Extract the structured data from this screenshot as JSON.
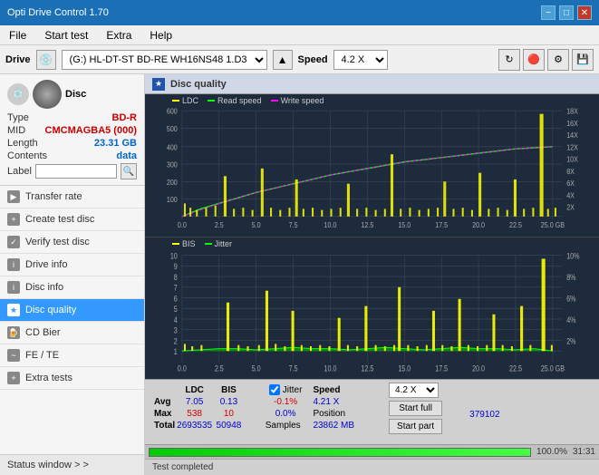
{
  "titlebar": {
    "title": "Opti Drive Control 1.70",
    "min_label": "−",
    "max_label": "□",
    "close_label": "✕"
  },
  "menubar": {
    "items": [
      "File",
      "Start test",
      "Extra",
      "Help"
    ]
  },
  "drivebar": {
    "label": "Drive",
    "drive_value": "(G:)  HL-DT-ST BD-RE  WH16NS48 1.D3",
    "speed_label": "Speed",
    "speed_value": "4.2 X"
  },
  "disc": {
    "title": "Disc",
    "type_label": "Type",
    "type_value": "BD-R",
    "mid_label": "MID",
    "mid_value": "CMCMAGBA5 (000)",
    "length_label": "Length",
    "length_value": "23.31 GB",
    "contents_label": "Contents",
    "contents_value": "data",
    "label_label": "Label"
  },
  "sidebar_nav": {
    "items": [
      {
        "id": "transfer-rate",
        "label": "Transfer rate",
        "active": false
      },
      {
        "id": "create-test-disc",
        "label": "Create test disc",
        "active": false
      },
      {
        "id": "verify-test-disc",
        "label": "Verify test disc",
        "active": false
      },
      {
        "id": "drive-info",
        "label": "Drive info",
        "active": false
      },
      {
        "id": "disc-info",
        "label": "Disc info",
        "active": false
      },
      {
        "id": "disc-quality",
        "label": "Disc quality",
        "active": true
      },
      {
        "id": "cd-bier",
        "label": "CD Bier",
        "active": false
      },
      {
        "id": "fe-te",
        "label": "FE / TE",
        "active": false
      },
      {
        "id": "extra-tests",
        "label": "Extra tests",
        "active": false
      }
    ],
    "status_window": "Status window > >"
  },
  "disc_quality": {
    "title": "Disc quality"
  },
  "chart1": {
    "legend": [
      {
        "label": "LDC",
        "color": "#ffff00"
      },
      {
        "label": "Read speed",
        "color": "#00ff00"
      },
      {
        "label": "Write speed",
        "color": "#ff00ff"
      }
    ],
    "y_max": 600,
    "y_labels": [
      "600",
      "500",
      "400",
      "300",
      "200",
      "100"
    ],
    "y_labels_right": [
      "18X",
      "16X",
      "14X",
      "12X",
      "10X",
      "8X",
      "6X",
      "4X",
      "2X"
    ],
    "x_labels": [
      "0.0",
      "2.5",
      "5.0",
      "7.5",
      "10.0",
      "12.5",
      "15.0",
      "17.5",
      "20.0",
      "22.5",
      "25.0 GB"
    ]
  },
  "chart2": {
    "legend": [
      {
        "label": "BIS",
        "color": "#ffff00"
      },
      {
        "label": "Jitter",
        "color": "#00ff00"
      }
    ],
    "y_max": 10,
    "y_labels": [
      "10",
      "9",
      "8",
      "7",
      "6",
      "5",
      "4",
      "3",
      "2",
      "1"
    ],
    "y_labels_right": [
      "10%",
      "8%",
      "6%",
      "4%",
      "2%"
    ],
    "x_labels": [
      "0.0",
      "2.5",
      "5.0",
      "7.5",
      "10.0",
      "12.5",
      "15.0",
      "17.5",
      "20.0",
      "22.5",
      "25.0 GB"
    ]
  },
  "stats": {
    "headers": [
      "",
      "LDC",
      "BIS",
      "",
      "Jitter",
      "Speed"
    ],
    "avg_label": "Avg",
    "avg_ldc": "7.05",
    "avg_bis": "0.13",
    "avg_jitter": "-0.1%",
    "avg_speed": "4.21 X",
    "max_label": "Max",
    "max_ldc": "538",
    "max_bis": "10",
    "max_jitter": "0.0%",
    "max_position": "23862 MB",
    "total_label": "Total",
    "total_ldc": "2693535",
    "total_bis": "50948",
    "total_samples": "379102",
    "position_label": "Position",
    "samples_label": "Samples",
    "jitter_checked": true,
    "jitter_label": "Jitter",
    "speed_dropdown": "4.2 X",
    "start_full_label": "Start full",
    "start_part_label": "Start part"
  },
  "progress": {
    "percent": 100,
    "percent_text": "100.0%",
    "time": "31:31"
  },
  "statusbar": {
    "text": "Test completed"
  }
}
